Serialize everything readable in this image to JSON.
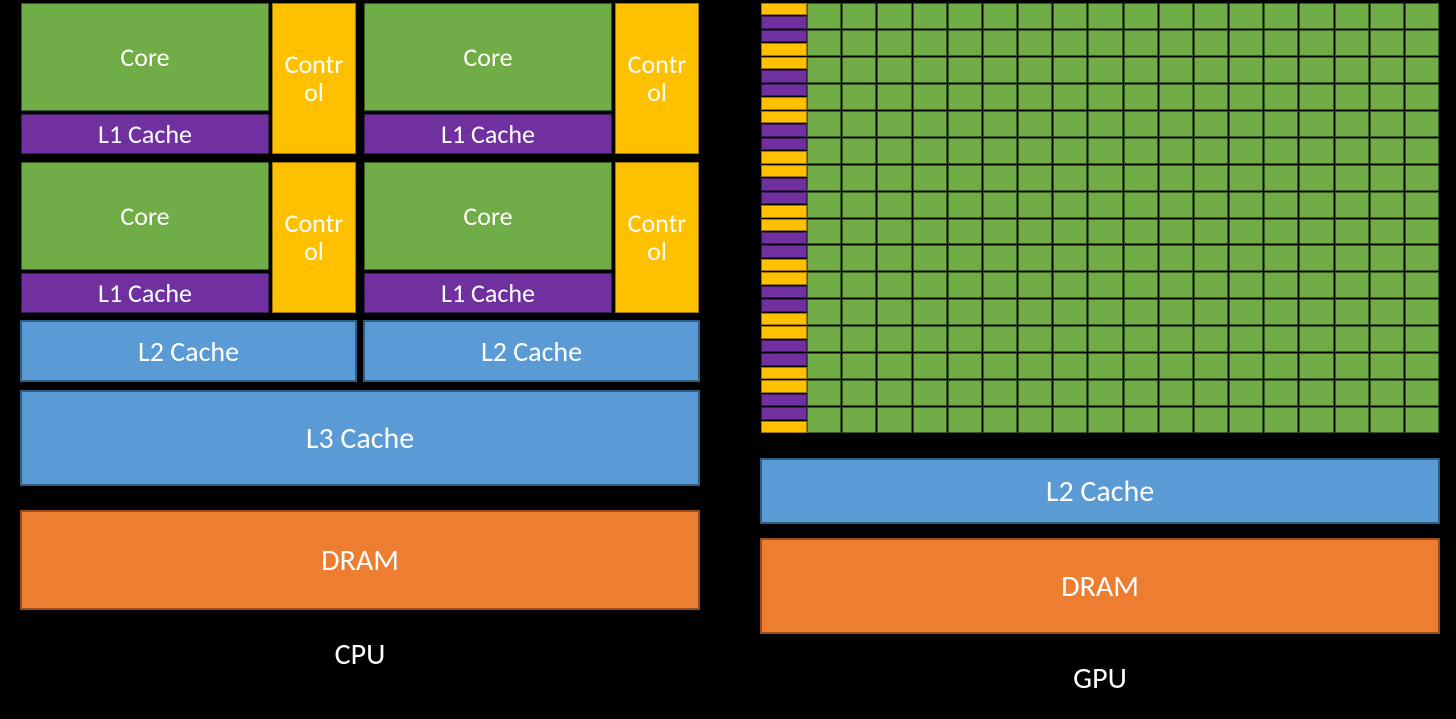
{
  "colors": {
    "core": "#70ad47",
    "control": "#ffc000",
    "l1": "#7030a0",
    "cache": "#5b9bd5",
    "dram": "#ed7d31"
  },
  "cpu": {
    "label": "CPU",
    "cores": [
      {
        "core_label": "Core",
        "control_label": "Control",
        "l1_label": "L1 Cache"
      },
      {
        "core_label": "Core",
        "control_label": "Control",
        "l1_label": "L1 Cache"
      },
      {
        "core_label": "Core",
        "control_label": "Control",
        "l1_label": "L1 Cache"
      },
      {
        "core_label": "Core",
        "control_label": "Control",
        "l1_label": "L1 Cache"
      }
    ],
    "l2": [
      "L2 Cache",
      "L2 Cache"
    ],
    "l3_label": "L3 Cache",
    "dram_label": "DRAM"
  },
  "gpu": {
    "label": "GPU",
    "sm_rows": 16,
    "core_cols": 18,
    "l2_label": "L2 Cache",
    "dram_label": "DRAM"
  },
  "chart_data": {
    "type": "table",
    "title": "CPU vs GPU architecture diagram",
    "cpu": {
      "core_count": 4,
      "per_core": [
        "Core",
        "Control",
        "L1 Cache"
      ],
      "shared_caches": [
        "L2 Cache (x2)",
        "L3 Cache"
      ],
      "memory": "DRAM"
    },
    "gpu": {
      "grid_rows": 16,
      "grid_cols": 18,
      "per_row_side_units": [
        "Control",
        "L1"
      ],
      "shared_caches": [
        "L2 Cache"
      ],
      "memory": "DRAM"
    }
  }
}
